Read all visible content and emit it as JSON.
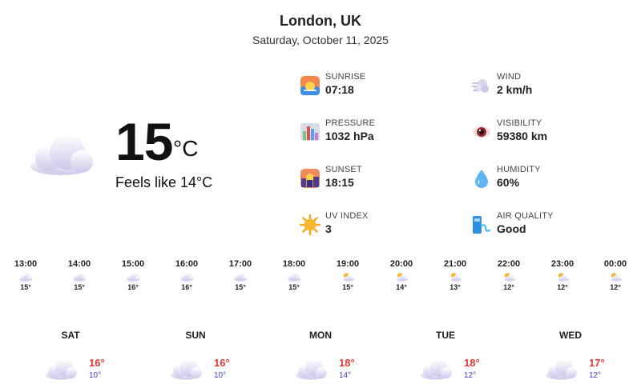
{
  "location": {
    "city": "London, UK",
    "date": "Saturday, October 11, 2025"
  },
  "current": {
    "temperature": "15",
    "unit": "°C",
    "feels_like": "Feels like 14°C",
    "condition_icon": "cloud-icon"
  },
  "metrics": [
    {
      "label": "SUNRISE",
      "value": "07:18",
      "icon": "sunrise-icon"
    },
    {
      "label": "WIND",
      "value": "2 km/h",
      "icon": "wind-icon"
    },
    {
      "label": "PRESSURE",
      "value": "1032 hPa",
      "icon": "pressure-icon"
    },
    {
      "label": "VISIBILITY",
      "value": "59380 km",
      "icon": "eye-icon"
    },
    {
      "label": "SUNSET",
      "value": "18:15",
      "icon": "sunset-icon"
    },
    {
      "label": "HUMIDITY",
      "value": "60%",
      "icon": "droplet-icon"
    },
    {
      "label": "UV INDEX",
      "value": "3",
      "icon": "sun-icon"
    },
    {
      "label": "AIR QUALITY",
      "value": "Good",
      "icon": "air-quality-icon"
    }
  ],
  "hourly": [
    {
      "time": "13:00",
      "temp": "15°",
      "icon": "cloud-icon"
    },
    {
      "time": "14:00",
      "temp": "15°",
      "icon": "cloud-icon"
    },
    {
      "time": "15:00",
      "temp": "16°",
      "icon": "cloud-icon"
    },
    {
      "time": "16:00",
      "temp": "16°",
      "icon": "cloud-icon"
    },
    {
      "time": "17:00",
      "temp": "15°",
      "icon": "cloud-icon"
    },
    {
      "time": "18:00",
      "temp": "15°",
      "icon": "cloud-icon"
    },
    {
      "time": "19:00",
      "temp": "15°",
      "icon": "partly-cloudy-icon"
    },
    {
      "time": "20:00",
      "temp": "14°",
      "icon": "partly-cloudy-icon"
    },
    {
      "time": "21:00",
      "temp": "13°",
      "icon": "partly-cloudy-icon"
    },
    {
      "time": "22:00",
      "temp": "12°",
      "icon": "partly-cloudy-icon"
    },
    {
      "time": "23:00",
      "temp": "12°",
      "icon": "partly-cloudy-icon"
    },
    {
      "time": "00:00",
      "temp": "12°",
      "icon": "partly-cloudy-icon"
    }
  ],
  "daily": [
    {
      "day": "SAT",
      "high": "16°",
      "low": "10°",
      "icon": "cloud-icon"
    },
    {
      "day": "SUN",
      "high": "16°",
      "low": "10°",
      "icon": "cloud-icon"
    },
    {
      "day": "MON",
      "high": "18°",
      "low": "14°",
      "icon": "cloud-icon"
    },
    {
      "day": "TUE",
      "high": "18°",
      "low": "12°",
      "icon": "cloud-icon"
    },
    {
      "day": "WED",
      "high": "17°",
      "low": "12°",
      "icon": "cloud-icon"
    }
  ],
  "colors": {
    "high_temp": "#e53935",
    "low_temp": "#3f3fc8",
    "cloud": "#e8e4f4"
  }
}
